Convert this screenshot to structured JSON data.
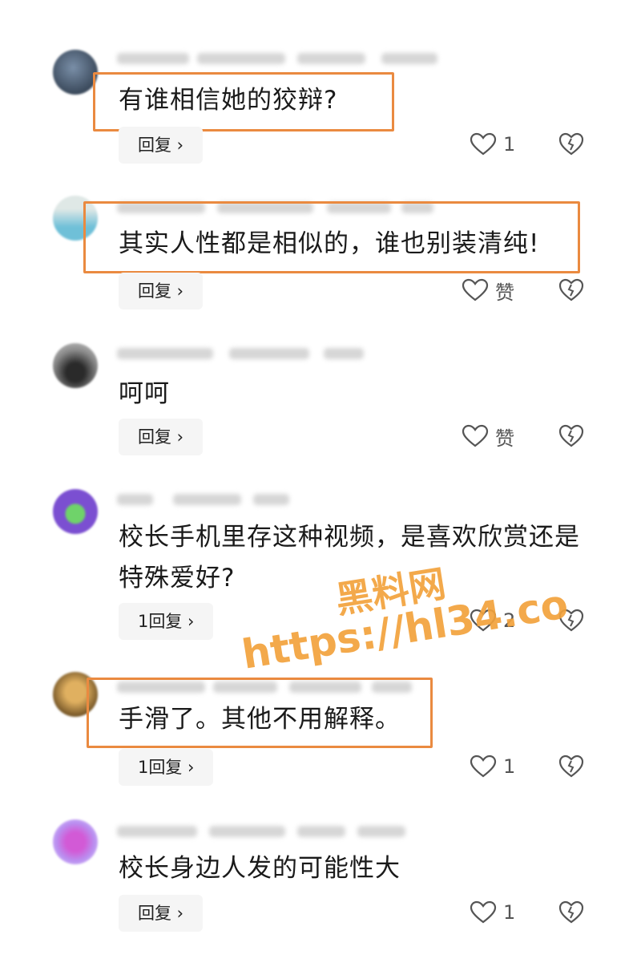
{
  "comments": [
    {
      "text": "有谁相信她的狡辩?",
      "reply_label": "回复 ›",
      "likes": "1"
    },
    {
      "text": "其实人性都是相似的，谁也别装清纯!",
      "reply_label": "回复 ›",
      "likes": "赞"
    },
    {
      "text": "呵呵",
      "reply_label": "回复 ›",
      "likes": "赞"
    },
    {
      "text": "校长手机里存这种视频，是喜欢欣赏还是",
      "text_line2": "特殊爱好?",
      "reply_label": "1回复 ›",
      "likes": "2"
    },
    {
      "text": "手滑了。其他不用解释。",
      "reply_label": "1回复 ›",
      "likes": "1"
    },
    {
      "text": "校长身边人发的可能性大",
      "reply_label": "回复 ›",
      "likes": "1"
    }
  ],
  "watermark": {
    "line1": "黑料网",
    "line2": "https://hl34.co"
  },
  "colors": {
    "highlight": "#ea8a40",
    "watermark": "#f2a23c",
    "reply_bg": "#f5f5f5"
  },
  "icons": {
    "like": "heart-outline-icon",
    "dislike": "broken-heart-icon"
  }
}
